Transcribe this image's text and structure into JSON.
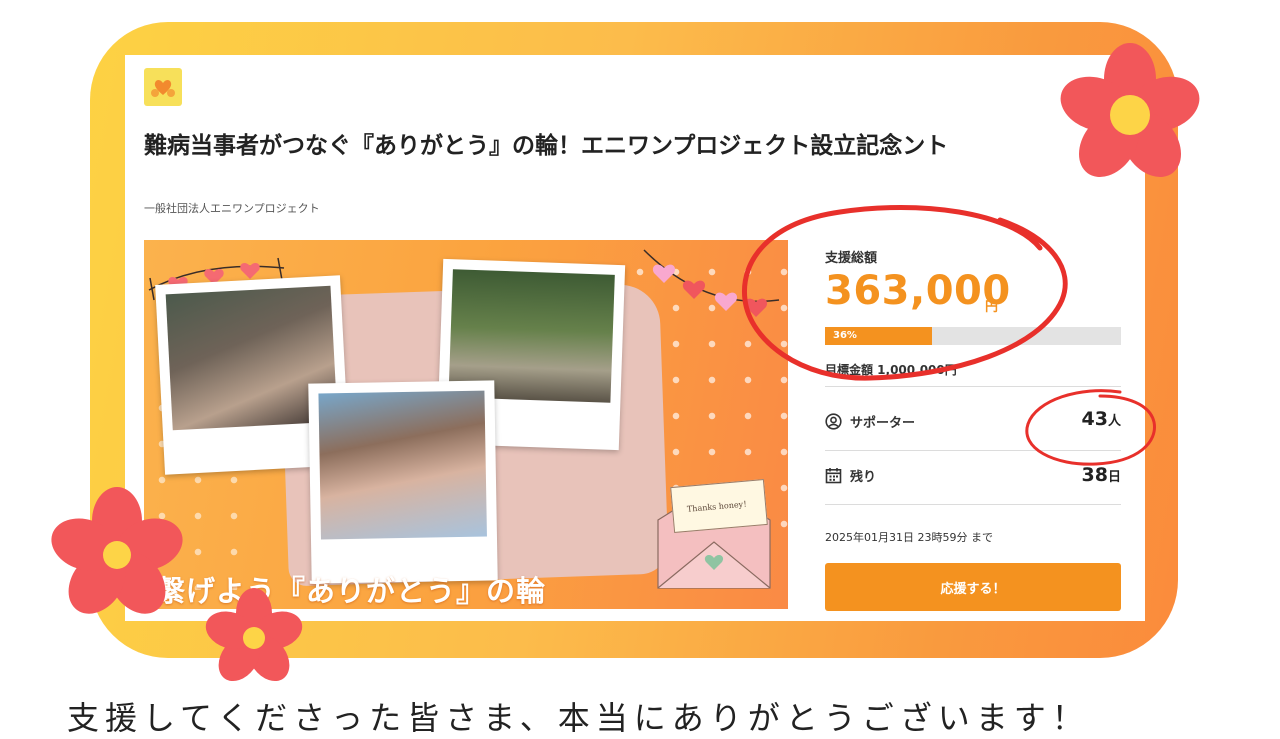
{
  "project": {
    "title": "難病当事者がつなぐ『ありがとう』の輪！エニワンプロジェクト設立記念ント",
    "organization": "一般社団法人エニワンプロジェクト",
    "logo_icon": "heart-hands-icon"
  },
  "hero": {
    "overlay_text": "繋げよう『ありがとう』の輪",
    "note_text": "Thanks honey！"
  },
  "stats": {
    "total_label": "支援総額",
    "total_amount": "363,000",
    "currency": "円",
    "progress_percent": 36,
    "progress_label": "36%",
    "goal_text": "目標金額 1,000,000円",
    "supporters_label": "サポーター",
    "supporters_count": "43",
    "supporters_unit": "人",
    "remaining_label": "残り",
    "remaining_days": "38",
    "remaining_unit": "日",
    "deadline_text": "2025年01月31日 23時59分 まで",
    "support_button": "応援する！"
  },
  "caption": "支援してくださった皆さま、本当にありがとうございます！",
  "colors": {
    "accent": "#f4921f",
    "frame_start": "#fdd243",
    "frame_end": "#fb8b3c",
    "flower": "#f2575a",
    "flower_center": "#fdd447",
    "annotation_red": "#e8302b"
  }
}
